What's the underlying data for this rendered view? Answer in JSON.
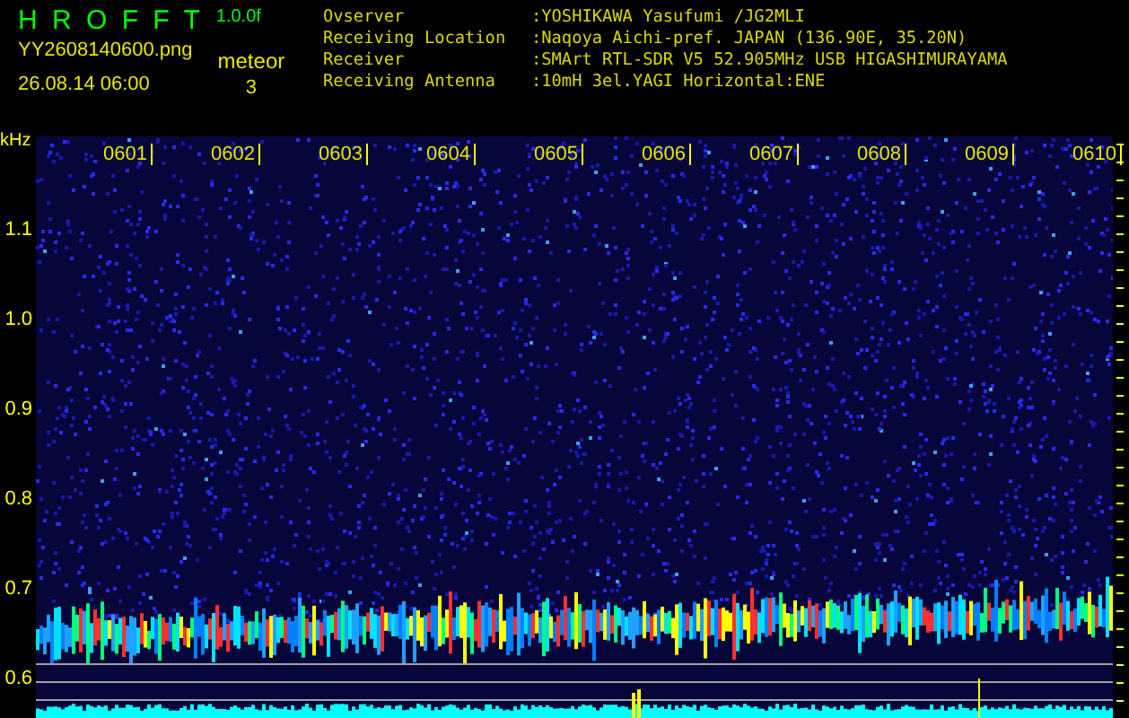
{
  "header": {
    "logo": "H R O F F T",
    "version": "1.0.0f",
    "filename": "YY2608140600.png",
    "datetime": "26.08.14 06:00",
    "meteor_label": "meteor",
    "meteor_count": "3"
  },
  "station_info": [
    {
      "label": "Ovserver",
      "value": ":YOSHIKAWA Yasufumi /JG2MLI"
    },
    {
      "label": "Receiving Location",
      "value": ":Naqoya Aichi-pref. JAPAN (136.90E, 35.20N)"
    },
    {
      "label": "Receiver",
      "value": ":SMArt RTL-SDR V5 52.905MHz USB HIGASHIMURAYAMA"
    },
    {
      "label": "Receiving Antenna",
      "value": ":10mH 3el.YAGI Horizontal:ENE"
    }
  ],
  "frequency_axis": {
    "unit": "kHz",
    "labels": [
      "1.1",
      "1.0",
      "0.9",
      "0.8",
      "0.7",
      "0.6"
    ]
  },
  "time_axis": {
    "labels": [
      "0601",
      "0602",
      "0603",
      "0604",
      "0605",
      "0606",
      "0607",
      "0608",
      "0609",
      "0610"
    ]
  }
}
